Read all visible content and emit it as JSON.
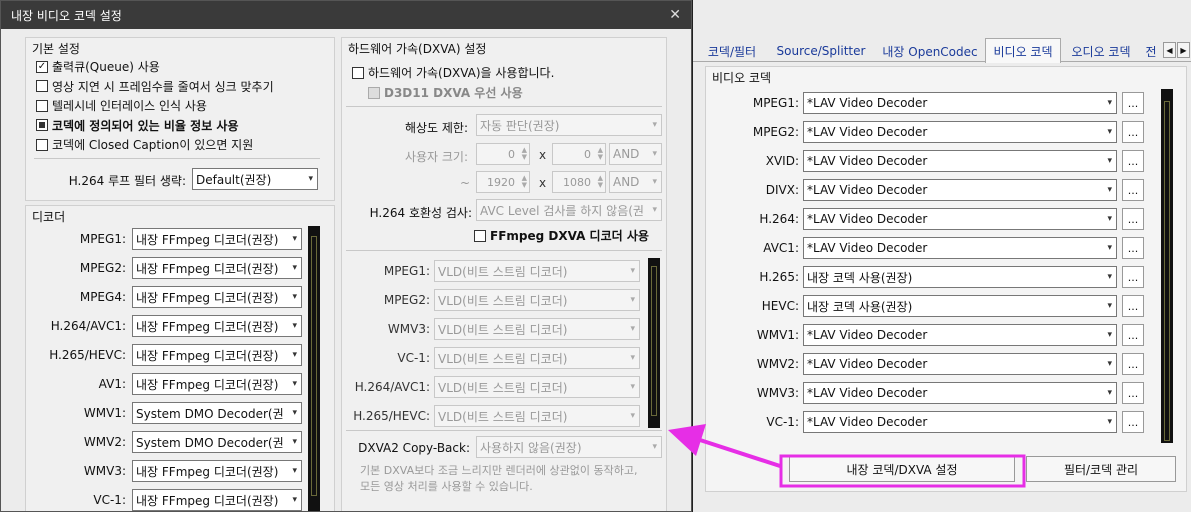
{
  "dialog": {
    "title": "내장 비디오 코덱 설정",
    "close": "✕",
    "basic": {
      "title": "기본 설정",
      "options": [
        {
          "label": "출력큐(Queue) 사용",
          "state": "checked"
        },
        {
          "label": "영상 지연 시 프레임수를 줄여서 싱크 맞추기",
          "state": "off"
        },
        {
          "label": "텔레시네 인터레이스 인식 사용",
          "state": "off"
        },
        {
          "label": "코덱에 정의되어 있는 비율 정보 사용",
          "state": "filled"
        },
        {
          "label": "코덱에 Closed Caption이 있으면 지원",
          "state": "off"
        }
      ],
      "loop_filter_label": "H.264 루프 필터 생략:",
      "loop_filter_value": "Default(권장)"
    },
    "decoder": {
      "title": "디코더",
      "rows": [
        {
          "label": "MPEG1:",
          "value": "내장 FFmpeg 디코더(권장)"
        },
        {
          "label": "MPEG2:",
          "value": "내장 FFmpeg 디코더(권장)"
        },
        {
          "label": "MPEG4:",
          "value": "내장 FFmpeg 디코더(권장)"
        },
        {
          "label": "H.264/AVC1:",
          "value": "내장 FFmpeg 디코더(권장)"
        },
        {
          "label": "H.265/HEVC:",
          "value": "내장 FFmpeg 디코더(권장)"
        },
        {
          "label": "AV1:",
          "value": "내장 FFmpeg 디코더(권장)"
        },
        {
          "label": "WMV1:",
          "value": "System DMO Decoder(권"
        },
        {
          "label": "WMV2:",
          "value": "System DMO Decoder(권"
        },
        {
          "label": "WMV3:",
          "value": "내장 FFmpeg 디코더(권장)"
        },
        {
          "label": "VC-1:",
          "value": "내장 FFmpeg 디코더(권장)"
        }
      ]
    },
    "hw": {
      "title": "하드웨어 가속(DXVA) 설정",
      "enable_label": "하드웨어 가속(DXVA)을 사용합니다.",
      "d3d11_label": "D3D11 DXVA 우선 사용",
      "resolution_label": "해상도 제한:",
      "resolution_value": "자동 판단(권장)",
      "user_size_label": "사용자 크기:",
      "min_w": "0",
      "min_h": "0",
      "min_op": "AND",
      "tilde": "~",
      "max_w": "1920",
      "max_h": "1080",
      "max_op": "AND",
      "times": "x",
      "compat_label": "H.264 호환성 검사:",
      "compat_value": "AVC Level 검사를 하지 않음(권",
      "ffmpeg_dxva_label": "FFmpeg DXVA 디코더 사용",
      "modes": [
        {
          "label": "MPEG1:",
          "value": "VLD(비트 스트림 디코더)"
        },
        {
          "label": "MPEG2:",
          "value": "VLD(비트 스트림 디코더)"
        },
        {
          "label": "WMV3:",
          "value": "VLD(비트 스트림 디코더)"
        },
        {
          "label": "VC-1:",
          "value": "VLD(비트 스트림 디코더)"
        },
        {
          "label": "H.264/AVC1:",
          "value": "VLD(비트 스트림 디코더)"
        },
        {
          "label": "H.265/HEVC:",
          "value": "VLD(비트 스트림 디코더)"
        }
      ],
      "copyback_label": "DXVA2 Copy-Back:",
      "copyback_value": "사용하지 않음(권장)",
      "note_line1": "기본 DXVA보다 조금 느리지만 렌더러에 상관없이 동작하고,",
      "note_line2": "모든 영상 처리를 사용할 수 있습니다."
    }
  },
  "prefs": {
    "tabs": [
      "코덱/필터",
      "Source/Splitter",
      "내장 OpenCodec",
      "비디오 코덱",
      "오디오 코덱",
      "전"
    ],
    "active_tab": 3,
    "group_title": "비디오 코덱",
    "rows": [
      {
        "label": "MPEG1:",
        "value": "*LAV Video Decoder"
      },
      {
        "label": "MPEG2:",
        "value": "*LAV Video Decoder"
      },
      {
        "label": "XVID:",
        "value": "*LAV Video Decoder"
      },
      {
        "label": "DIVX:",
        "value": "*LAV Video Decoder"
      },
      {
        "label": "H.264:",
        "value": "*LAV Video Decoder"
      },
      {
        "label": "AVC1:",
        "value": "*LAV Video Decoder"
      },
      {
        "label": "H.265:",
        "value": "내장 코덱 사용(권장)"
      },
      {
        "label": "HEVC:",
        "value": "내장 코덱 사용(권장)"
      },
      {
        "label": "WMV1:",
        "value": "*LAV Video Decoder"
      },
      {
        "label": "WMV2:",
        "value": "*LAV Video Decoder"
      },
      {
        "label": "WMV3:",
        "value": "*LAV Video Decoder"
      },
      {
        "label": "VC-1:",
        "value": "*LAV Video Decoder"
      }
    ],
    "dots": "...",
    "builtin_button": "내장 코덱/DXVA 설정",
    "filter_button": "필터/코덱 관리"
  },
  "highlight_color": "#e62ee6",
  "scroll_thumb_color": "#6a6a3a"
}
